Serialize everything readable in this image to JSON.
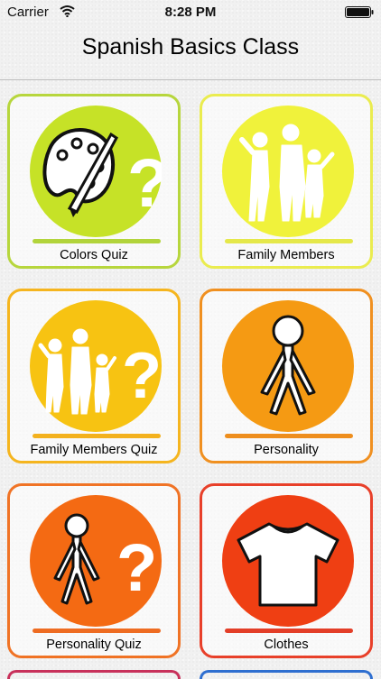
{
  "status_bar": {
    "carrier": "Carrier",
    "time": "8:28 PM",
    "wifi_icon": "wifi-icon",
    "battery_icon": "battery-icon"
  },
  "app": {
    "title": "Spanish Basics Class"
  },
  "tiles": [
    {
      "label": "Colors Quiz",
      "icon": "palette-quiz-icon",
      "circle_color": "#c6e227",
      "border_color": "#b7d63d",
      "bar_color": "#b2d43b"
    },
    {
      "label": "Family Members",
      "icon": "family-icon",
      "circle_color": "#f0f23b",
      "border_color": "#eaec4f",
      "bar_color": "#e5e84a"
    },
    {
      "label": "Family Members Quiz",
      "icon": "family-quiz-icon",
      "circle_color": "#f7c312",
      "border_color": "#f5b51f",
      "bar_color": "#f3b11d"
    },
    {
      "label": "Personality",
      "icon": "stick-person-icon",
      "circle_color": "#f59a13",
      "border_color": "#f09020",
      "bar_color": "#ee8e1d"
    },
    {
      "label": "Personality Quiz",
      "icon": "stick-person-quiz-icon",
      "circle_color": "#f46a13",
      "border_color": "#f07325",
      "bar_color": "#ee6c22"
    },
    {
      "label": "Clothes",
      "icon": "tshirt-icon",
      "circle_color": "#ef3f13",
      "border_color": "#e8402a",
      "bar_color": "#e33e28"
    }
  ],
  "peek_tiles": [
    {
      "border_color": "#c8315b"
    },
    {
      "border_color": "#2f6fd0"
    }
  ]
}
